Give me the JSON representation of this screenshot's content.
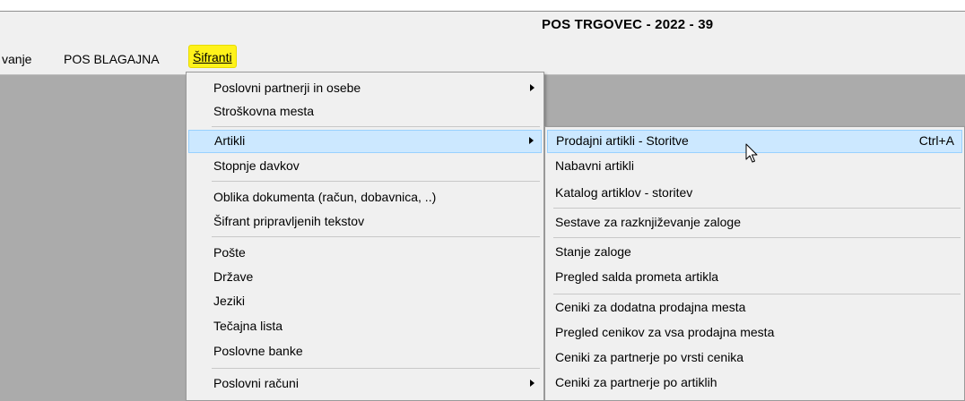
{
  "window": {
    "title": "POS TRGOVEC - 2022 - 39"
  },
  "menubar": {
    "items": [
      {
        "label": "vanje"
      },
      {
        "label": "POS BLAGAJNA"
      },
      {
        "label": "Šifranti"
      }
    ]
  },
  "main_menu": {
    "items": [
      {
        "label": "Poslovni partnerji in osebe"
      },
      {
        "label": "Stroškovna mesta"
      },
      {
        "label": "Artikli"
      },
      {
        "label": "Stopnje davkov"
      },
      {
        "label": "Oblika dokumenta (račun, dobavnica, ..)"
      },
      {
        "label": "Šifrant pripravljenih tekstov"
      },
      {
        "label": "Pošte"
      },
      {
        "label": "Države"
      },
      {
        "label": "Jeziki"
      },
      {
        "label": "Tečajna lista"
      },
      {
        "label": "Poslovne banke"
      },
      {
        "label": "Poslovni računi"
      }
    ]
  },
  "submenu": {
    "items": [
      {
        "label": "Prodajni artikli - Storitve",
        "shortcut": "Ctrl+A"
      },
      {
        "label": "Nabavni artikli"
      },
      {
        "label": "Katalog artiklov - storitev"
      },
      {
        "label": "Sestave za razknjiževanje zaloge"
      },
      {
        "label": "Stanje zaloge"
      },
      {
        "label": "Pregled salda prometa artikla"
      },
      {
        "label": "Ceniki za dodatna prodajna mesta"
      },
      {
        "label": "Pregled cenikov za vsa prodajna mesta"
      },
      {
        "label": "Ceniki za partnerje po vrsti cenika"
      },
      {
        "label": "Ceniki za partnerje po artiklih"
      }
    ]
  },
  "colors": {
    "highlight": "#cce8ff",
    "highlight_border": "#99d1ff",
    "active_menu": "#fff21a",
    "workspace": "#ababab"
  }
}
